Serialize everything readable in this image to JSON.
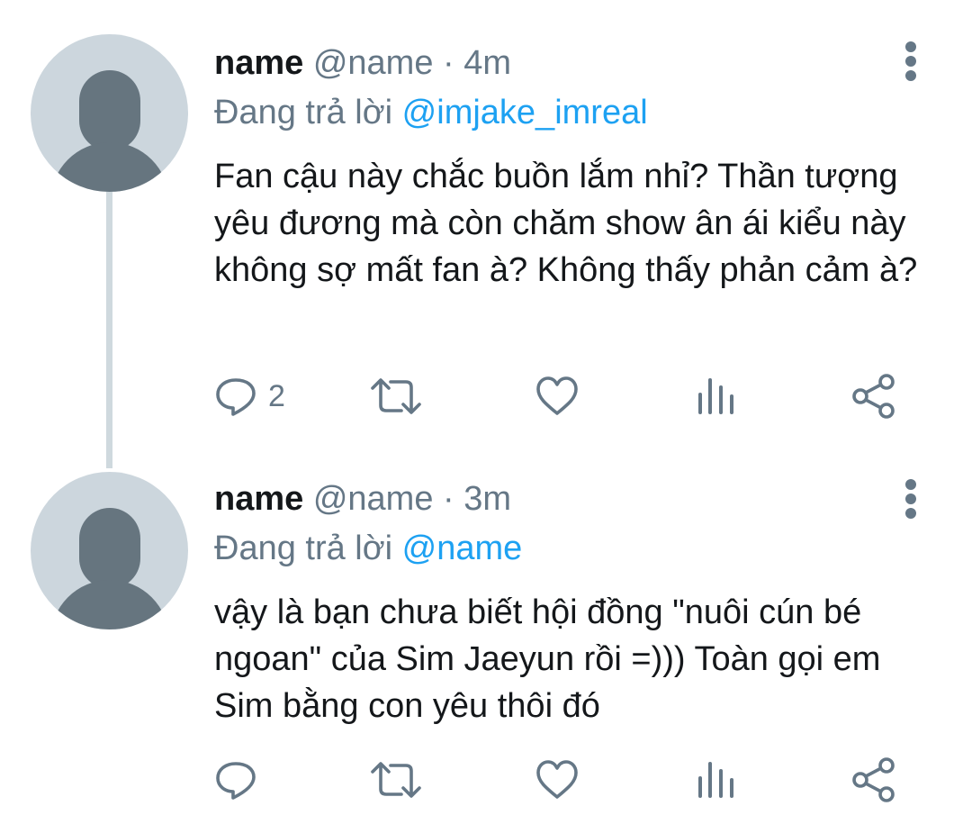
{
  "tweets": [
    {
      "name": "name",
      "handle": "@name",
      "separator": "·",
      "time": "4m",
      "reply_prefix": "Đang trả lời",
      "reply_to": "@imjake_imreal",
      "text": "Fan cậu này chắc buồn lắm nhỉ? Thần tượng yêu đương mà còn chăm show ân ái kiểu này không sợ mất fan à? Không thấy phản cảm à?",
      "reply_count": "2"
    },
    {
      "name": "name",
      "handle": "@name",
      "separator": "·",
      "time": "3m",
      "reply_prefix": "Đang trả lời",
      "reply_to": "@name",
      "text": "vậy là bạn chưa biết hội đồng \"nuôi cún bé ngoan\" của Sim Jaeyun rồi =))) Toàn gọi em Sim bằng con yêu thôi đó",
      "reply_count": ""
    }
  ],
  "icons": {
    "reply": "reply-icon",
    "retweet": "retweet-icon",
    "like": "heart-icon",
    "stats": "analytics-icon",
    "share": "share-icon",
    "more": "more-vertical-icon"
  },
  "colors": {
    "text": "#14171a",
    "secondary": "#657786",
    "mention": "#1da1f2",
    "avatar_bg": "#ccd6dd",
    "avatar_fg": "#66757f",
    "thread_line": "#cfd9de"
  }
}
